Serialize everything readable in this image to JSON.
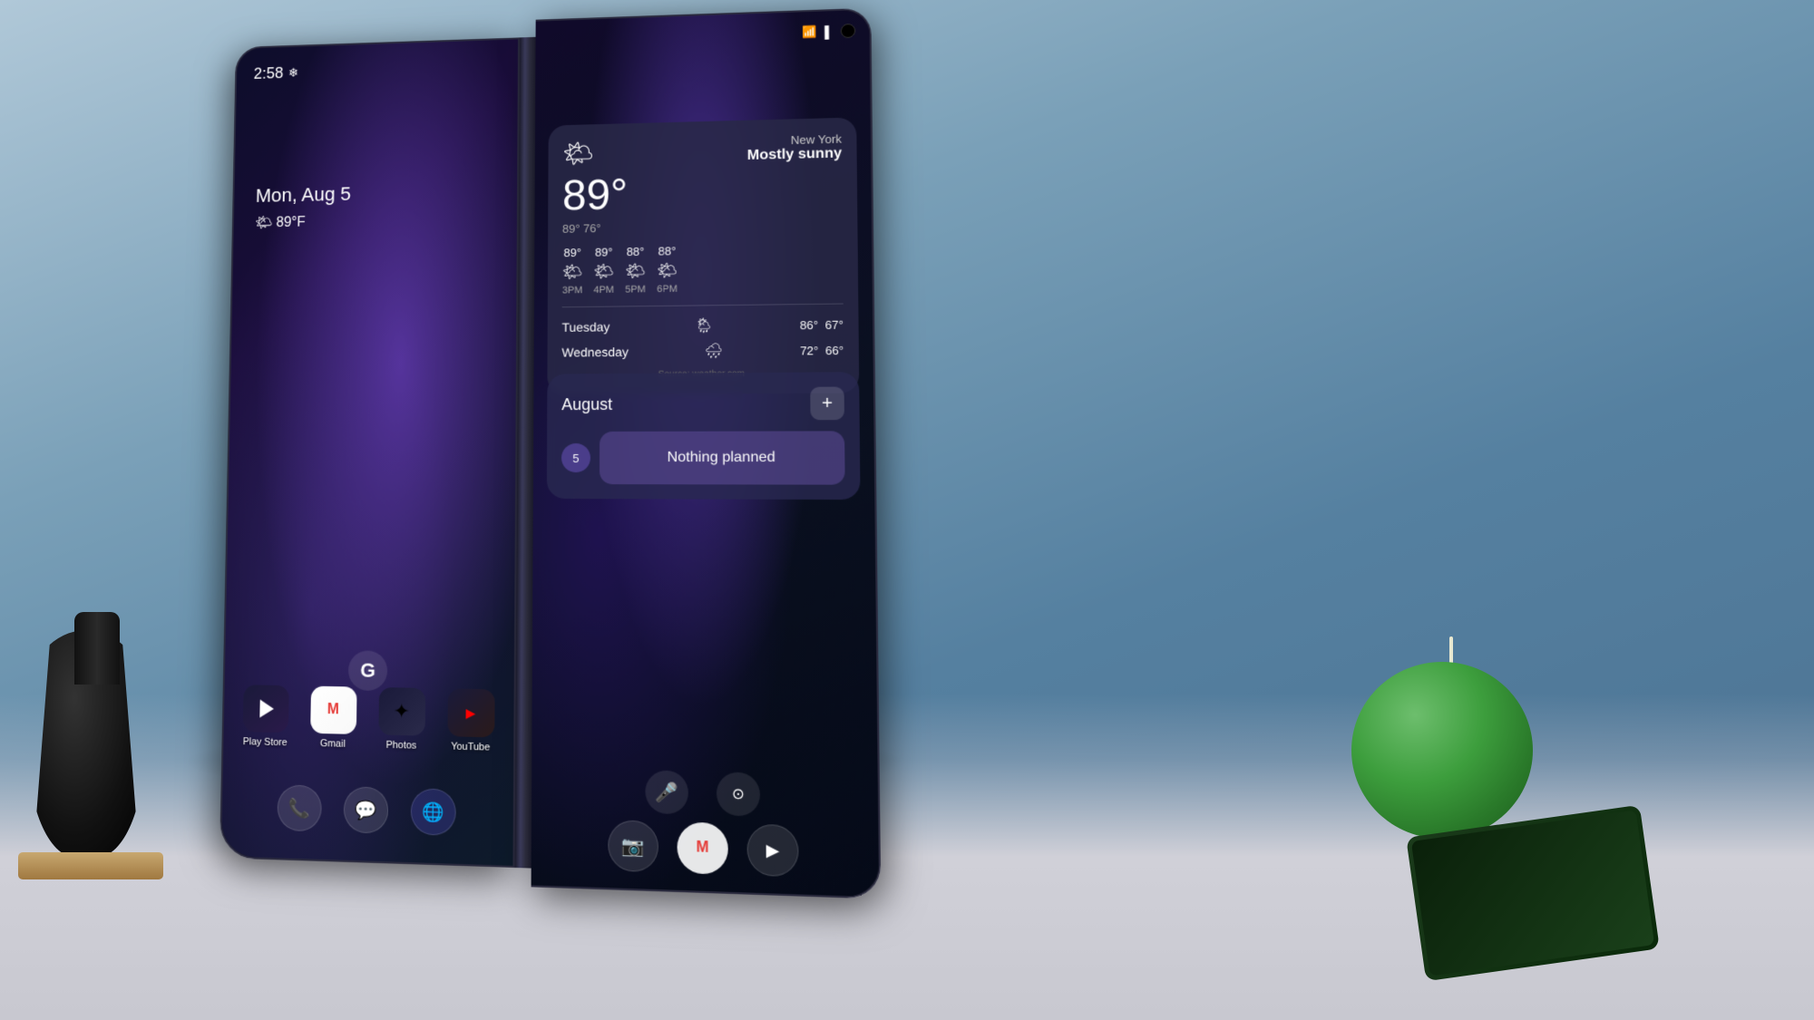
{
  "background": {
    "color": "#6a8fa8"
  },
  "left_screen": {
    "status_time": "2:58",
    "status_icon": "❄",
    "date": "Mon, Aug 5",
    "temperature": "🌤 89°F",
    "apps": [
      {
        "name": "Play Store",
        "emoji": "▶",
        "label": "Play Store"
      },
      {
        "name": "Gmail",
        "emoji": "M",
        "label": "Gmail"
      },
      {
        "name": "Photos",
        "emoji": "❋",
        "label": "Photos"
      },
      {
        "name": "YouTube",
        "emoji": "▶",
        "label": "YouTube"
      }
    ],
    "google_label": "G",
    "dock_icons": [
      "📞",
      "💬",
      "🔵"
    ]
  },
  "right_screen": {
    "status_icons": [
      "WiFi",
      "Signal",
      "camera"
    ],
    "weather": {
      "location": "New York",
      "condition": "Mostly sunny",
      "temp_big": "89°",
      "low_high": "89° 76°",
      "hourly": [
        {
          "temp": "89°",
          "icon": "🌤",
          "time": "3PM"
        },
        {
          "temp": "89°",
          "icon": "🌤",
          "time": "4PM"
        },
        {
          "temp": "88°",
          "icon": "🌤",
          "time": "5PM"
        },
        {
          "temp": "88°",
          "icon": "🌤",
          "time": "6PM"
        }
      ],
      "forecast": [
        {
          "day": "Tuesday",
          "icon": "🌦",
          "high": "86°",
          "low": "67°"
        },
        {
          "day": "Wednesday",
          "icon": "🌧",
          "high": "72°",
          "low": "66°"
        }
      ],
      "source": "Source: weather.com"
    },
    "calendar": {
      "month": "August",
      "add_button": "+",
      "day_number": "5",
      "nothing_planned": "Nothing planned"
    },
    "search_icons": [
      "🎤",
      "🔍"
    ],
    "dock_icons": [
      "📷",
      "M",
      "▶"
    ]
  }
}
